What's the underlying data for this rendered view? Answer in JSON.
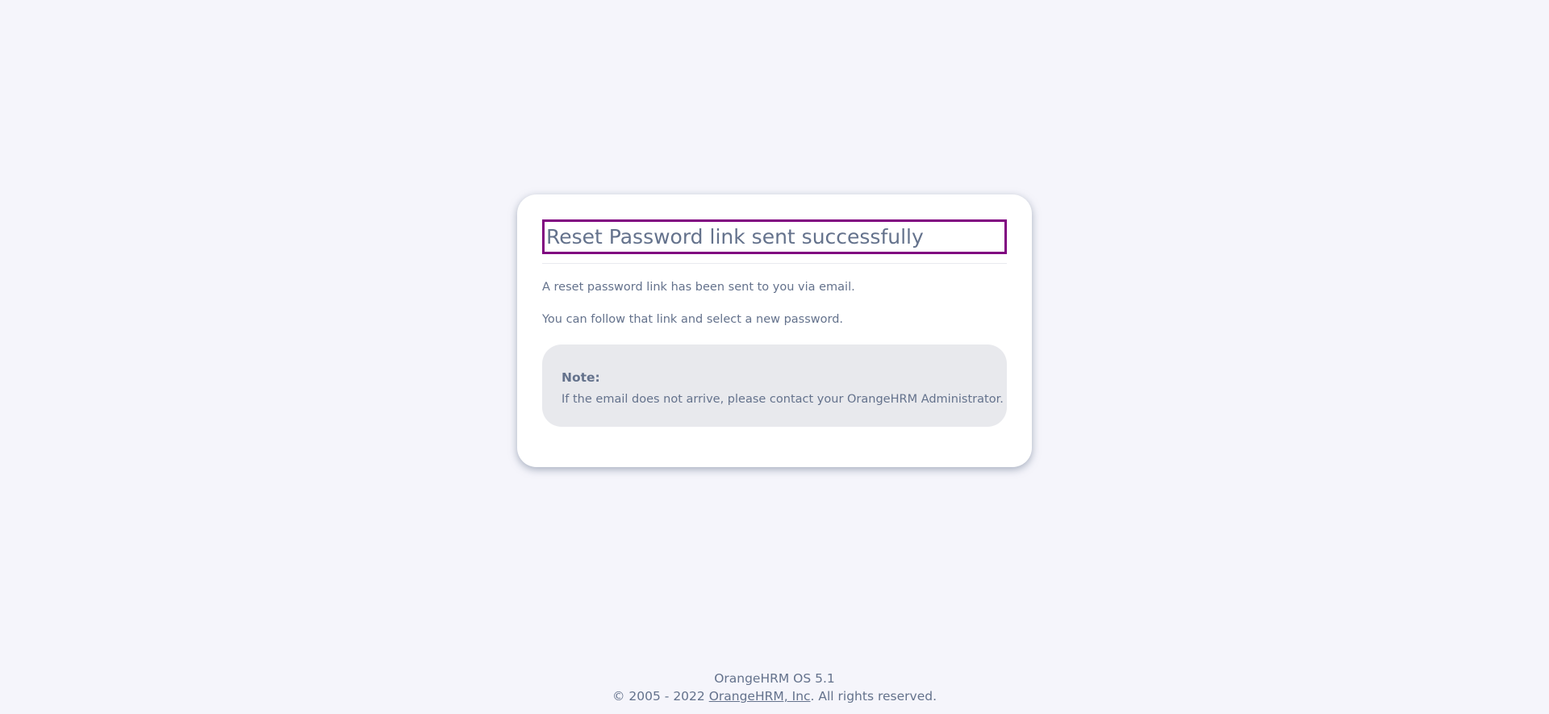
{
  "card": {
    "title": "Reset Password link sent successfully",
    "paragraph1": "A reset password link has been sent to you via email.",
    "paragraph2": "You can follow that link and select a new password.",
    "note": {
      "label": "Note:",
      "text": "If the email does not arrive, please contact your OrangeHRM Administrator."
    }
  },
  "footer": {
    "version": "OrangeHRM OS 5.1",
    "copyright_prefix": "© 2005 - 2022 ",
    "company_link": "OrangeHRM, Inc",
    "copyright_suffix": ". All rights reserved."
  },
  "colors": {
    "background": "#f5f5fb",
    "text": "#64728c",
    "title_outline": "#800080",
    "note_background": "#e8e9ed"
  }
}
